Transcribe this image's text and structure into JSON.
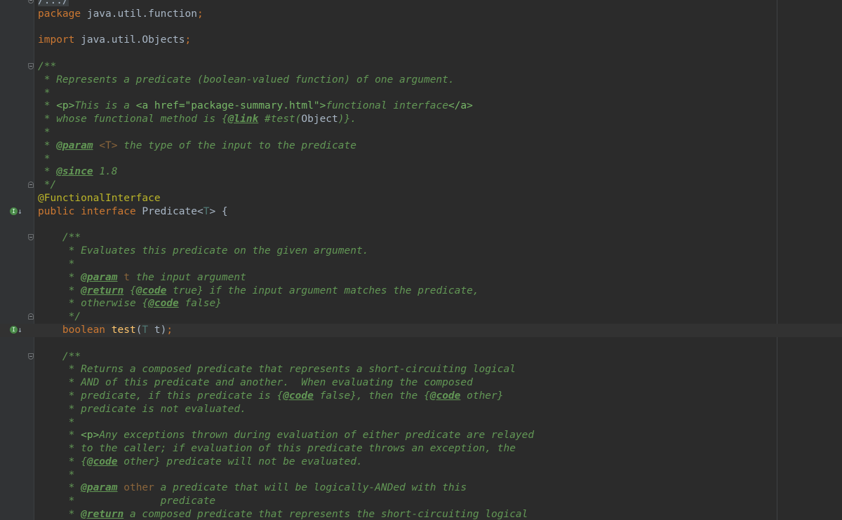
{
  "editor": {
    "language": "java",
    "theme": "darcula",
    "colors": {
      "background": "#2b2b2b",
      "gutter": "#313335",
      "keyword": "#cc7832",
      "doc_comment": "#629755",
      "annotation": "#bbb529",
      "method": "#ffc66d",
      "identifier": "#a9b7c6"
    },
    "lines": [
      {
        "gutter": "fold-open",
        "tokens": [
          {
            "c": "t-fold",
            "t": "/.../"
          }
        ]
      },
      {
        "tokens": [
          {
            "c": "t-kw",
            "t": "package "
          },
          {
            "c": "t-id",
            "t": "java.util.function"
          },
          {
            "c": "t-semi",
            "t": ";"
          }
        ]
      },
      {
        "tokens": []
      },
      {
        "tokens": [
          {
            "c": "t-kw",
            "t": "import "
          },
          {
            "c": "t-id",
            "t": "java.util.Objects"
          },
          {
            "c": "t-semi",
            "t": ";"
          }
        ]
      },
      {
        "tokens": []
      },
      {
        "gutter": "fold-open",
        "tokens": [
          {
            "c": "t-doc",
            "t": "/**"
          }
        ]
      },
      {
        "tokens": [
          {
            "c": "t-doc",
            "t": " * Represents a predicate (boolean-valued function) of one argument."
          }
        ]
      },
      {
        "tokens": [
          {
            "c": "t-doc",
            "t": " *"
          }
        ]
      },
      {
        "tokens": [
          {
            "c": "t-doc",
            "t": " * "
          },
          {
            "c": "t-html",
            "t": "<p>"
          },
          {
            "c": "t-doc",
            "t": "This is a "
          },
          {
            "c": "t-html",
            "t": "<a href=\"package-summary.html\">"
          },
          {
            "c": "t-doc",
            "t": "functional interface"
          },
          {
            "c": "t-html",
            "t": "</a>"
          }
        ]
      },
      {
        "tokens": [
          {
            "c": "t-doc",
            "t": " * whose functional method is {"
          },
          {
            "c": "t-tag",
            "t": "@link"
          },
          {
            "c": "t-doc",
            "t": " #test("
          },
          {
            "c": "t-id",
            "t": "Object"
          },
          {
            "c": "t-doc",
            "t": ")}."
          }
        ]
      },
      {
        "tokens": [
          {
            "c": "t-doc",
            "t": " *"
          }
        ]
      },
      {
        "tokens": [
          {
            "c": "t-doc",
            "t": " * "
          },
          {
            "c": "t-tag",
            "t": "@param"
          },
          {
            "c": "t-doc",
            "t": " "
          },
          {
            "c": "t-docparam",
            "t": "<T>"
          },
          {
            "c": "t-doc",
            "t": " the type of the input to the predicate"
          }
        ]
      },
      {
        "tokens": [
          {
            "c": "t-doc",
            "t": " *"
          }
        ]
      },
      {
        "tokens": [
          {
            "c": "t-doc",
            "t": " * "
          },
          {
            "c": "t-tag",
            "t": "@since"
          },
          {
            "c": "t-doc",
            "t": " 1.8"
          }
        ]
      },
      {
        "gutter": "fold-closed",
        "tokens": [
          {
            "c": "t-doc",
            "t": " */"
          }
        ]
      },
      {
        "tokens": [
          {
            "c": "t-ann",
            "t": "@FunctionalInterface"
          }
        ]
      },
      {
        "gutter": "impl-marker",
        "tokens": [
          {
            "c": "t-kw",
            "t": "public interface "
          },
          {
            "c": "t-id",
            "t": "Predicate<"
          },
          {
            "c": "t-type",
            "t": "T"
          },
          {
            "c": "t-id",
            "t": "> {"
          }
        ]
      },
      {
        "tokens": []
      },
      {
        "gutter": "fold-open",
        "tokens": [
          {
            "c": "t-doc",
            "t": "    /**"
          }
        ]
      },
      {
        "tokens": [
          {
            "c": "t-doc",
            "t": "     * Evaluates this predicate on the given argument."
          }
        ]
      },
      {
        "tokens": [
          {
            "c": "t-doc",
            "t": "     *"
          }
        ]
      },
      {
        "tokens": [
          {
            "c": "t-doc",
            "t": "     * "
          },
          {
            "c": "t-tag",
            "t": "@param"
          },
          {
            "c": "t-doc",
            "t": " "
          },
          {
            "c": "t-docparam",
            "t": "t"
          },
          {
            "c": "t-doc",
            "t": " the input argument"
          }
        ]
      },
      {
        "tokens": [
          {
            "c": "t-doc",
            "t": "     * "
          },
          {
            "c": "t-tag",
            "t": "@return"
          },
          {
            "c": "t-doc",
            "t": " {"
          },
          {
            "c": "t-tag",
            "t": "@code"
          },
          {
            "c": "t-doc",
            "t": " true} if the input argument matches the predicate,"
          }
        ]
      },
      {
        "tokens": [
          {
            "c": "t-doc",
            "t": "     * otherwise {"
          },
          {
            "c": "t-tag",
            "t": "@code"
          },
          {
            "c": "t-doc",
            "t": " false}"
          }
        ]
      },
      {
        "gutter": "fold-closed",
        "tokens": [
          {
            "c": "t-doc",
            "t": "     */"
          }
        ]
      },
      {
        "highlight": true,
        "gutter": "impl-marker",
        "tokens": [
          {
            "c": "t-kw",
            "t": "    boolean "
          },
          {
            "c": "t-method",
            "t": "test"
          },
          {
            "c": "t-id",
            "t": "("
          },
          {
            "c": "t-type",
            "t": "T"
          },
          {
            "c": "t-id",
            "t": " t)"
          },
          {
            "c": "t-semi",
            "t": ";"
          }
        ]
      },
      {
        "tokens": []
      },
      {
        "gutter": "fold-open",
        "tokens": [
          {
            "c": "t-doc",
            "t": "    /**"
          }
        ]
      },
      {
        "tokens": [
          {
            "c": "t-doc",
            "t": "     * Returns a composed predicate that represents a short-circuiting logical"
          }
        ]
      },
      {
        "tokens": [
          {
            "c": "t-doc",
            "t": "     * AND of this predicate and another.  When evaluating the composed"
          }
        ]
      },
      {
        "tokens": [
          {
            "c": "t-doc",
            "t": "     * predicate, if this predicate is {"
          },
          {
            "c": "t-tag",
            "t": "@code"
          },
          {
            "c": "t-doc",
            "t": " false}, then the {"
          },
          {
            "c": "t-tag",
            "t": "@code"
          },
          {
            "c": "t-doc",
            "t": " other}"
          }
        ]
      },
      {
        "tokens": [
          {
            "c": "t-doc",
            "t": "     * predicate is not evaluated."
          }
        ]
      },
      {
        "tokens": [
          {
            "c": "t-doc",
            "t": "     *"
          }
        ]
      },
      {
        "tokens": [
          {
            "c": "t-doc",
            "t": "     * "
          },
          {
            "c": "t-html",
            "t": "<p>"
          },
          {
            "c": "t-doc",
            "t": "Any exceptions thrown during evaluation of either predicate are relayed"
          }
        ]
      },
      {
        "tokens": [
          {
            "c": "t-doc",
            "t": "     * to the caller; if evaluation of this predicate throws an exception, the"
          }
        ]
      },
      {
        "tokens": [
          {
            "c": "t-doc",
            "t": "     * {"
          },
          {
            "c": "t-tag",
            "t": "@code"
          },
          {
            "c": "t-doc",
            "t": " other} predicate will not be evaluated."
          }
        ]
      },
      {
        "tokens": [
          {
            "c": "t-doc",
            "t": "     *"
          }
        ]
      },
      {
        "tokens": [
          {
            "c": "t-doc",
            "t": "     * "
          },
          {
            "c": "t-tag",
            "t": "@param"
          },
          {
            "c": "t-doc",
            "t": " "
          },
          {
            "c": "t-docparam",
            "t": "other"
          },
          {
            "c": "t-doc",
            "t": " a predicate that will be logically-ANDed with this"
          }
        ]
      },
      {
        "tokens": [
          {
            "c": "t-doc",
            "t": "     *              predicate"
          }
        ]
      },
      {
        "tokens": [
          {
            "c": "t-doc",
            "t": "     * "
          },
          {
            "c": "t-tag",
            "t": "@return"
          },
          {
            "c": "t-doc",
            "t": " a composed predicate that represents the short-circuiting logical"
          }
        ]
      }
    ]
  }
}
